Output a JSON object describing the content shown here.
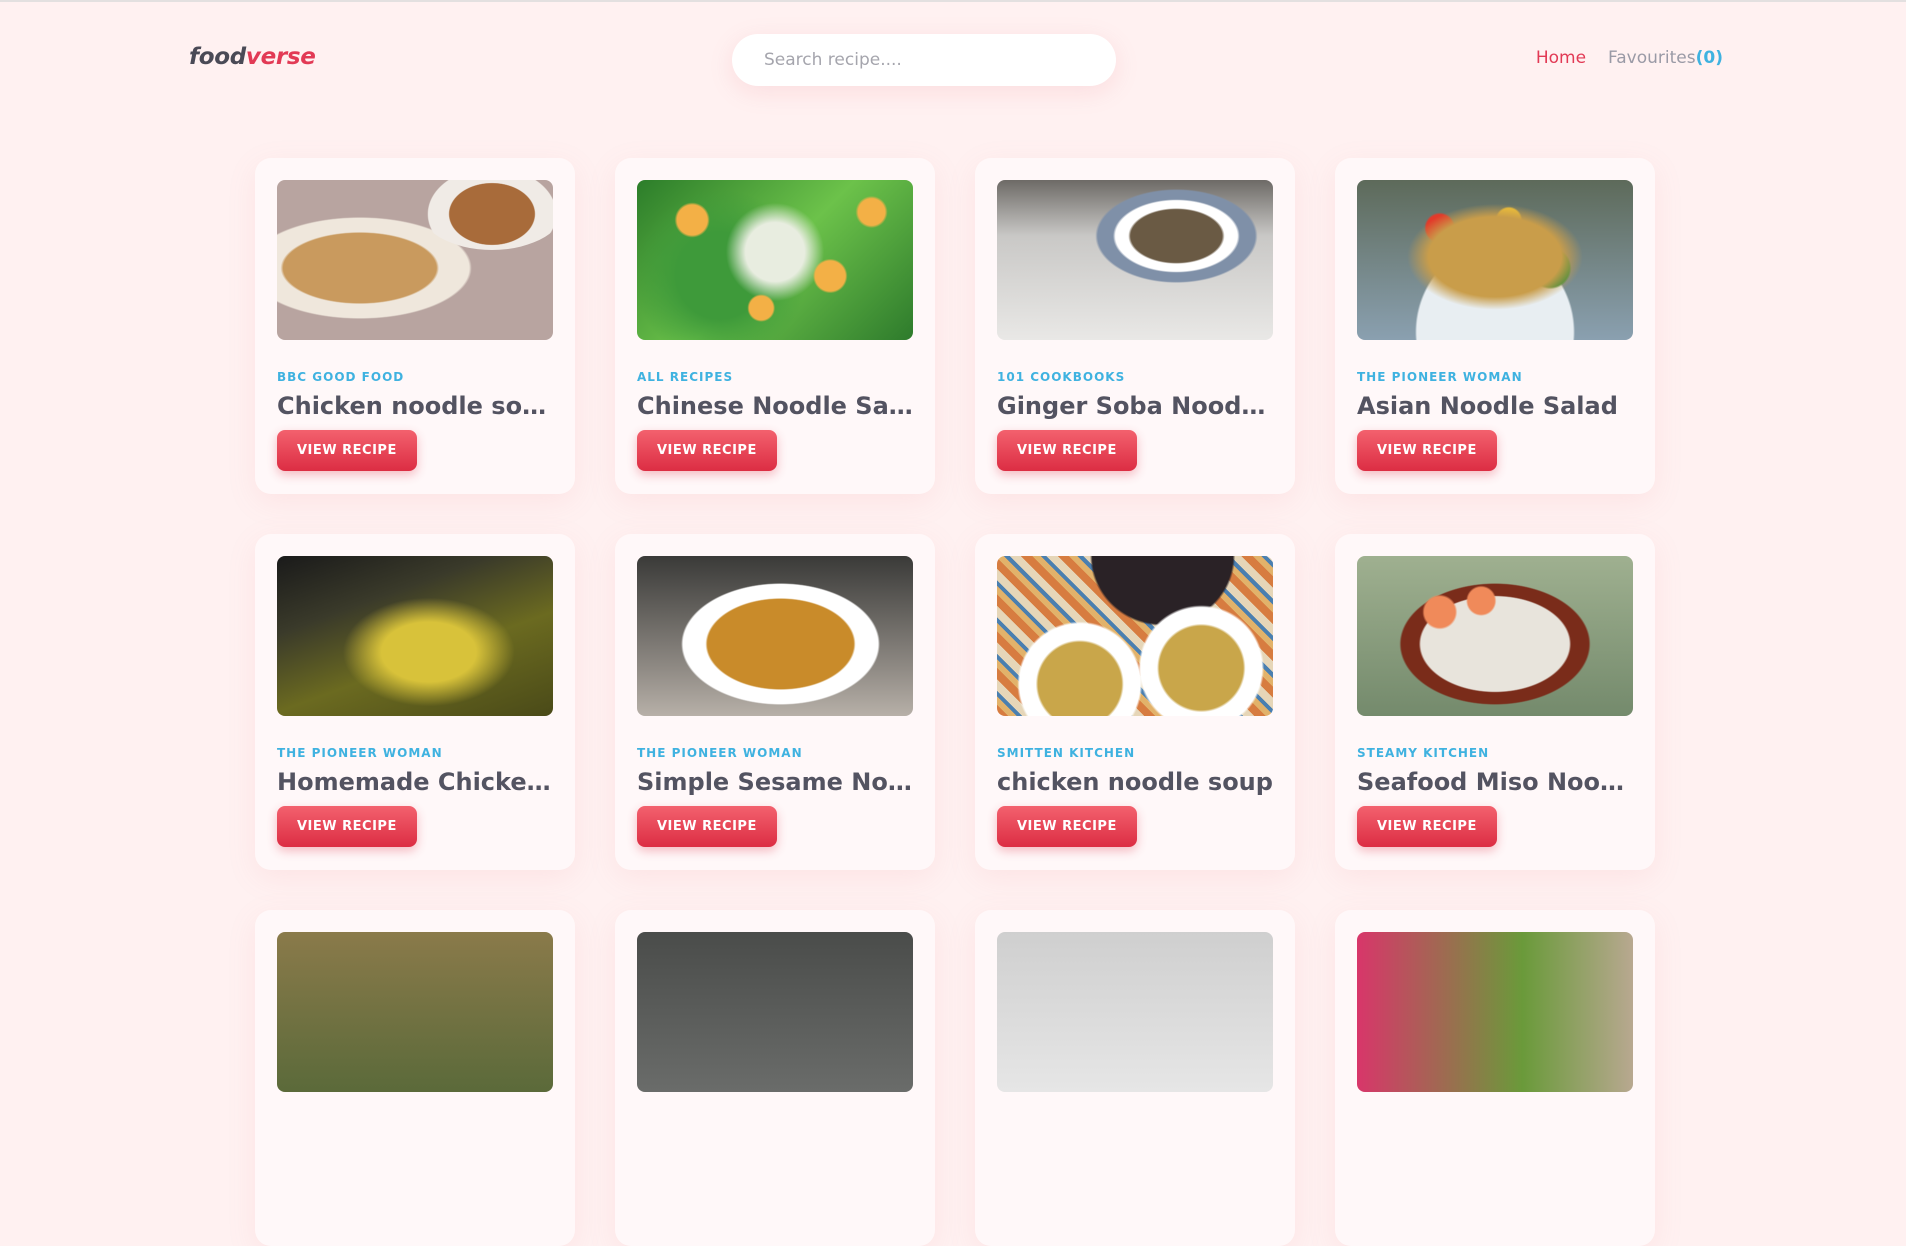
{
  "header": {
    "logo_part1": "food",
    "logo_part2": "verse",
    "search_placeholder": "Search recipe....",
    "nav": {
      "home": "Home",
      "favourites": "Favourites",
      "favourites_count": "(0)"
    }
  },
  "recipes": [
    {
      "publisher": "BBC GOOD FOOD",
      "title": "Chicken noodle soup",
      "button": "VIEW RECIPE"
    },
    {
      "publisher": "ALL RECIPES",
      "title": "Chinese Noodle Salad",
      "button": "VIEW RECIPE"
    },
    {
      "publisher": "101 COOKBOOKS",
      "title": "Ginger Soba Noodles",
      "button": "VIEW RECIPE"
    },
    {
      "publisher": "THE PIONEER WOMAN",
      "title": "Asian Noodle Salad",
      "button": "VIEW RECIPE"
    },
    {
      "publisher": "THE PIONEER WOMAN",
      "title": "Homemade Chicken a...",
      "button": "VIEW RECIPE"
    },
    {
      "publisher": "THE PIONEER WOMAN",
      "title": "Simple Sesame Noodl...",
      "button": "VIEW RECIPE"
    },
    {
      "publisher": "SMITTEN KITCHEN",
      "title": "chicken noodle soup",
      "button": "VIEW RECIPE"
    },
    {
      "publisher": "STEAMY KITCHEN",
      "title": "Seafood Miso Noodle ...",
      "button": "VIEW RECIPE"
    }
  ],
  "colors": {
    "background": "#fff1f1",
    "accent_red": "#e23a55",
    "accent_blue": "#3fb2e0",
    "text_dark": "#535361"
  }
}
